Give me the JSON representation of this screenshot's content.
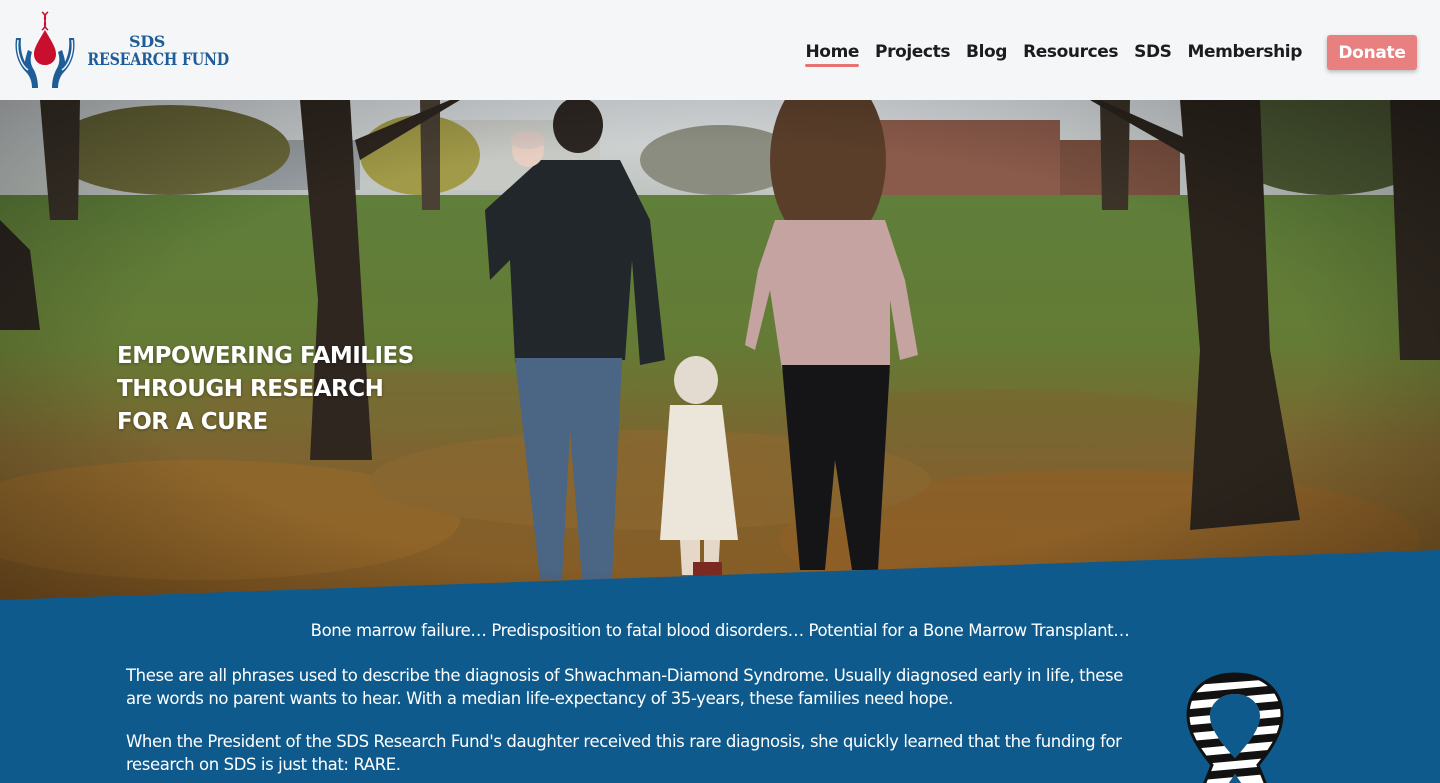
{
  "brand": {
    "line1": "SDS",
    "line2": "RESEARCH FUND"
  },
  "nav": {
    "items": [
      {
        "label": "Home"
      },
      {
        "label": "Projects"
      },
      {
        "label": "Blog"
      },
      {
        "label": "Resources"
      },
      {
        "label": "SDS"
      },
      {
        "label": "Membership"
      }
    ],
    "active": "Home",
    "donate_label": "Donate"
  },
  "hero": {
    "headline_lines": [
      "EMPOWERING FAMILIES",
      "THROUGH RESEARCH",
      "FOR A CURE"
    ]
  },
  "info": {
    "intro": "Bone marrow failure… Predisposition to fatal blood disorders… Potential for a Bone Marrow Transplant…",
    "paragraph1": "These are all phrases used to describe the diagnosis of Shwachman-Diamond Syndrome. Usually diagnosed early in life, these are words no parent wants to hear. With a median life-expectancy of 35-years, these families need hope.",
    "paragraph2": "When the President of the SDS Research Fund's daughter received this rare diagnosis, she quickly learned that the funding for research on SDS is just that: RARE."
  },
  "colors": {
    "header_bg": "#f5f6f8",
    "accent": "#e88080",
    "brand_blue": "#1f5d99",
    "section_blue": "#0f5a8c",
    "logo_red": "#c8102e"
  }
}
